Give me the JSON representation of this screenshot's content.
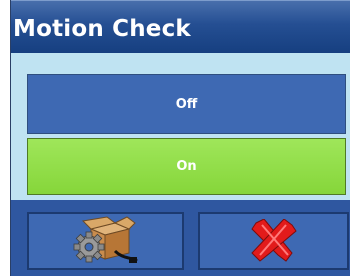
{
  "dialog": {
    "title": "Motion Check"
  },
  "options": [
    {
      "label": "Off",
      "selected": false
    },
    {
      "label": "On",
      "selected": true
    }
  ],
  "footer": {
    "setup_icon": "box-gear-icon",
    "cancel_icon": "red-x-icon"
  },
  "colors": {
    "title_bar": "#254f93",
    "panel_background": "#bfe3f2",
    "option_default": "#3e69b3",
    "option_selected": "#86d63a",
    "cancel_red": "#e21b1b"
  }
}
